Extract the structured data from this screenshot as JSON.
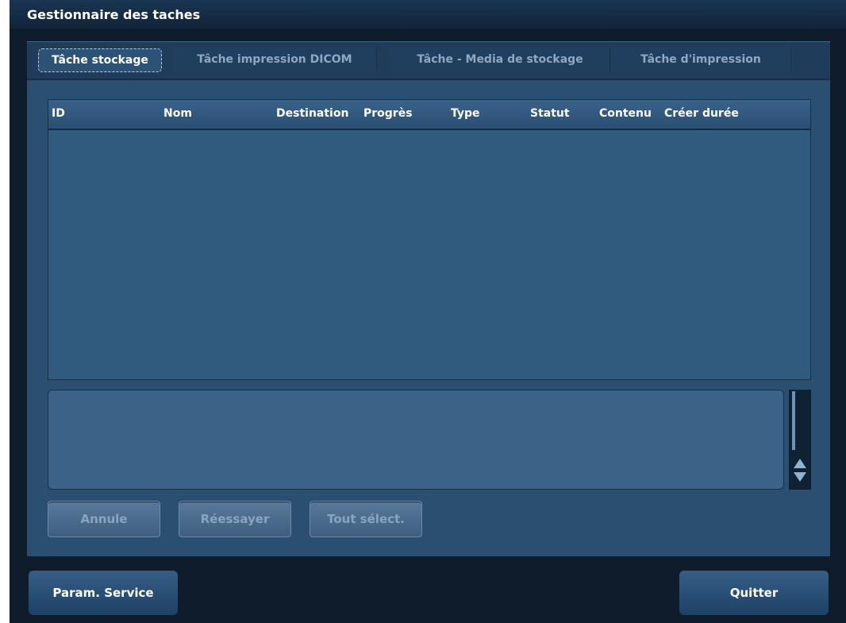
{
  "window": {
    "title": "Gestionnaire des taches"
  },
  "tabs": [
    {
      "label": "Tâche stockage",
      "active": true
    },
    {
      "label": "Tâche impression DICOM",
      "active": false
    },
    {
      "label": "Tâche - Media de stockage",
      "active": false
    },
    {
      "label": "Tâche d'impression",
      "active": false
    }
  ],
  "table": {
    "columns": [
      "ID",
      "Nom",
      "Destination",
      "Progrès",
      "Type",
      "Statut",
      "Contenu",
      "Créer durée"
    ],
    "rows": []
  },
  "actions": {
    "cancel": "Annule",
    "retry": "Réessayer",
    "select_all": "Tout sélect."
  },
  "footer": {
    "service_settings": "Param. Service",
    "quit": "Quitter"
  },
  "colors": {
    "window_bg": "#0f1c2b",
    "panel_bg": "#2a4f70",
    "table_bg": "#315a7f",
    "accent_text": "#ffffff"
  }
}
